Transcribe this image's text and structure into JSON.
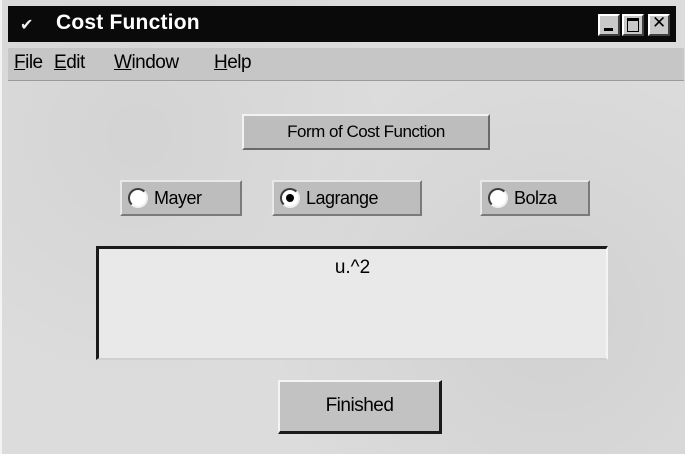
{
  "window": {
    "title": "Cost Function",
    "icon": "checkmark-icon",
    "controls": {
      "minimize": "minimize-icon",
      "maximize": "maximize-icon",
      "close": "✕"
    }
  },
  "menubar": {
    "items": [
      {
        "accel": "F",
        "rest": "ile"
      },
      {
        "accel": "E",
        "rest": "dit"
      },
      {
        "accel": "W",
        "rest": "indow"
      },
      {
        "accel": "H",
        "rest": "elp"
      }
    ]
  },
  "main": {
    "form_label": "Form of Cost Function",
    "radios": [
      {
        "label": "Mayer",
        "checked": false
      },
      {
        "label": "Lagrange",
        "checked": true
      },
      {
        "label": "Bolza",
        "checked": false
      }
    ],
    "cost_expression": "u.^2",
    "finished_label": "Finished"
  }
}
